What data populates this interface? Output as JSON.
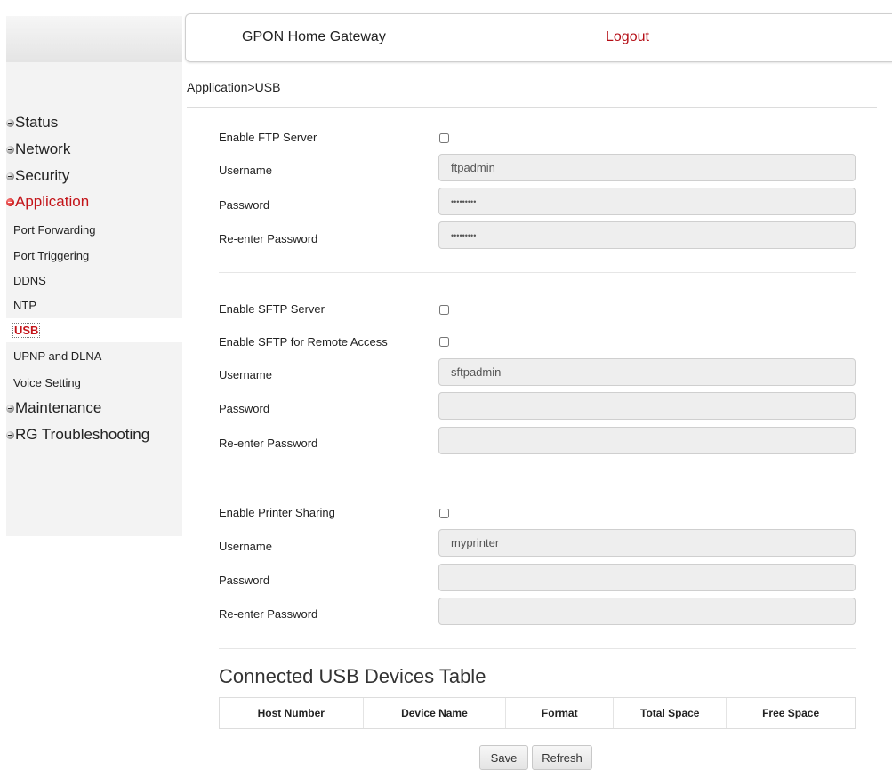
{
  "header": {
    "title": "GPON Home Gateway",
    "logout": "Logout"
  },
  "breadcrumb": "Application>USB",
  "sidebar": {
    "menus": [
      {
        "label": "Status",
        "active": false
      },
      {
        "label": "Network",
        "active": false
      },
      {
        "label": "Security",
        "active": false
      },
      {
        "label": "Application",
        "active": true
      },
      {
        "label": "Maintenance",
        "active": false
      },
      {
        "label": "RG Troubleshooting",
        "active": false
      }
    ],
    "submenu": [
      {
        "label": "Port Forwarding"
      },
      {
        "label": "Port Triggering"
      },
      {
        "label": "DDNS"
      },
      {
        "label": "NTP"
      },
      {
        "label": "USB",
        "selected": true
      },
      {
        "label": "UPNP and DLNA"
      },
      {
        "label": "Voice Setting"
      }
    ]
  },
  "ftp": {
    "enable_label": "Enable FTP Server",
    "enabled": false,
    "username_label": "Username",
    "username": "ftpadmin",
    "password_label": "Password",
    "password": "•••••••••",
    "reenter_label": "Re-enter Password",
    "reenter": "•••••••••"
  },
  "sftp": {
    "enable_label": "Enable SFTP Server",
    "enabled": false,
    "remote_label": "Enable SFTP for Remote Access",
    "remote_enabled": false,
    "username_label": "Username",
    "username": "sftpadmin",
    "password_label": "Password",
    "password": "",
    "reenter_label": "Re-enter Password",
    "reenter": ""
  },
  "printer": {
    "enable_label": "Enable Printer Sharing",
    "enabled": false,
    "username_label": "Username",
    "username": "myprinter",
    "password_label": "Password",
    "password": "",
    "reenter_label": "Re-enter Password",
    "reenter": ""
  },
  "usb_table": {
    "title": "Connected USB Devices Table",
    "columns": [
      "Host Number",
      "Device Name",
      "Format",
      "Total Space",
      "Free Space"
    ],
    "rows": []
  },
  "buttons": {
    "save": "Save",
    "refresh": "Refresh"
  }
}
